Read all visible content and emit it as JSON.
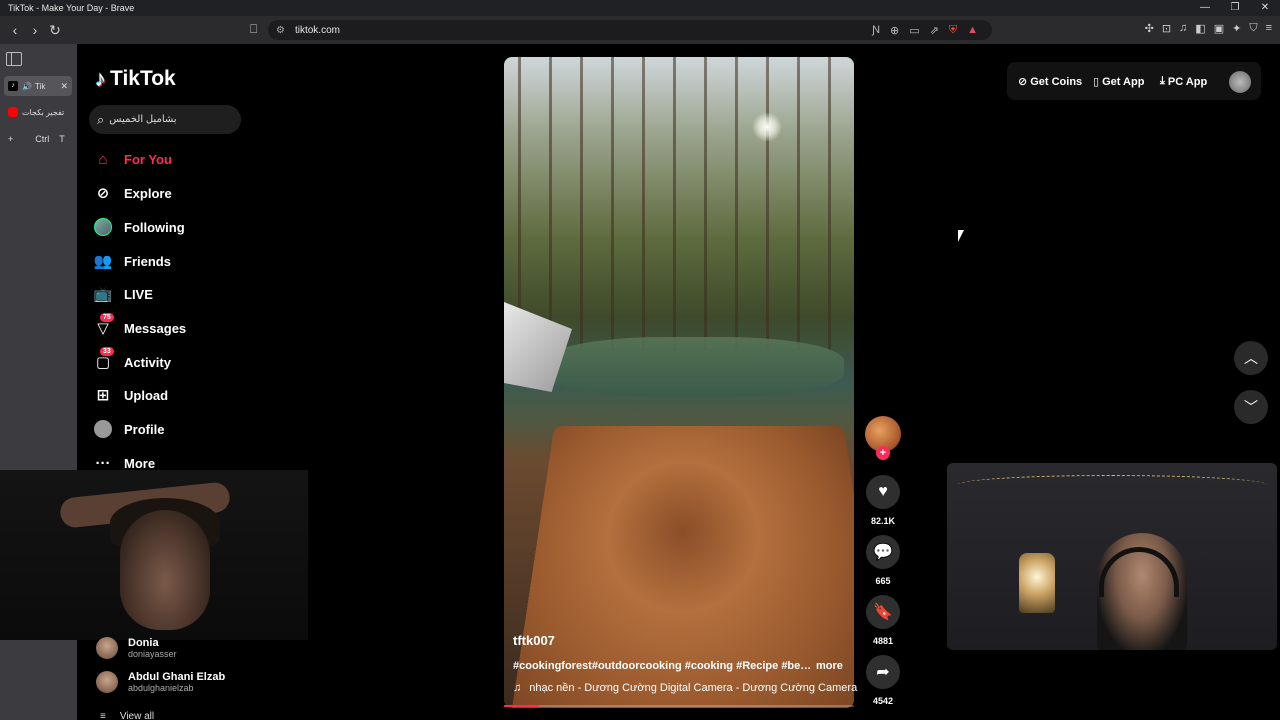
{
  "window": {
    "title": "TikTok - Make Your Day - Brave",
    "controls": [
      "—",
      "❐",
      "✕"
    ]
  },
  "browser": {
    "url": "tiktok.com",
    "tabs": [
      {
        "label": "Tik",
        "active": true
      },
      {
        "label": "تفجير بكجات",
        "active": false
      }
    ],
    "new_tab_shortcut": [
      "Ctrl",
      "T"
    ]
  },
  "tiktok": {
    "logo_text": "TikTok",
    "search": {
      "value": "بشاميل الخميس"
    },
    "menu": [
      {
        "label": "For You",
        "icon": "home-icon",
        "active": true
      },
      {
        "label": "Explore",
        "icon": "compass-icon"
      },
      {
        "label": "Following",
        "icon": "following-avatar"
      },
      {
        "label": "Friends",
        "icon": "friends-icon"
      },
      {
        "label": "LIVE",
        "icon": "live-icon"
      },
      {
        "label": "Messages",
        "icon": "messages-icon",
        "badge": "75"
      },
      {
        "label": "Activity",
        "icon": "activity-icon",
        "badge": "33"
      },
      {
        "label": "Upload",
        "icon": "upload-icon"
      },
      {
        "label": "Profile",
        "icon": "profile-avatar"
      },
      {
        "label": "More",
        "icon": "more-icon"
      }
    ],
    "following_accounts": [
      {
        "name": "Donia",
        "handle": "doniayasser"
      },
      {
        "name": "Abdul Ghani Elzab",
        "handle": "abdulghanielzab"
      }
    ],
    "view_all": "View all",
    "header": {
      "get_coins": "Get Coins",
      "get_app": "Get App",
      "pc_app": "PC App"
    },
    "video": {
      "author": "tftk007",
      "caption": "#cookingforest#outdoorcooking #cooking #Recipe #beef...",
      "more": "more",
      "music": "nhạc nền - Dương Cường Digital Camera - Dương Cường Camera",
      "progress": 0.1
    },
    "actions": {
      "likes": "82.1K",
      "comments": "665",
      "saves": "4881",
      "shares": "4542"
    }
  },
  "colors": {
    "accent": "#fe2c55",
    "background": "#000000",
    "sidebar_tabs": "#3c3c40"
  }
}
